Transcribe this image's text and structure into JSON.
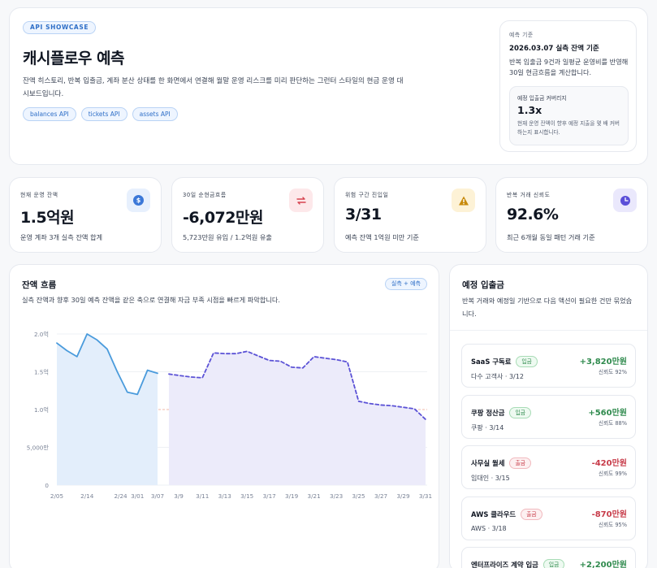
{
  "hero": {
    "badge": "API SHOWCASE",
    "title": "캐시플로우 예측",
    "description": "잔액 히스토리, 반복 입출금, 계좌 분산 상태를 한 화면에서 연결해 월말 운영 리스크를 미리 판단하는 그런터 스타일의 현금 운영 대시보드입니다.",
    "chips": [
      "balances API",
      "tickets API",
      "assets API"
    ]
  },
  "forecast_basis": {
    "label": "예측 기준",
    "date_line": "2026.03.07 실측 잔액 기준",
    "description": "반복 입출금 9건과 일평균 운영비를 반영해 30일 현금흐름을 계산합니다.",
    "coverage": {
      "label": "예정 입출금 커버리지",
      "value": "1.3x",
      "description": "현재 운영 잔액이 향후 예정 지출을 몇 배 커버하는지 표시합니다."
    }
  },
  "kpis": [
    {
      "label": "현재 운영 잔액",
      "value": "1.5억원",
      "sub": "운영 계좌 3개 실측 잔액 합계",
      "icon": "dollar-icon",
      "icon_glyph": "$",
      "icon_bg": "#e7f0fd",
      "icon_color": "#3b78d8"
    },
    {
      "label": "30일 순현금흐름",
      "value": "-6,072만원",
      "sub": "5,723만원 유입 / 1.2억원 유출",
      "icon": "repeat-icon",
      "icon_glyph": "⇄",
      "icon_bg": "#fde8ea",
      "icon_color": "#d6434f"
    },
    {
      "label": "위험 구간 진입일",
      "value": "3/31",
      "sub": "예측 잔액 1억원 미만 기준",
      "icon": "warning-icon",
      "icon_glyph": "!",
      "icon_bg": "#fdf2d6",
      "icon_color": "#c88a0a"
    },
    {
      "label": "반복 거래 신뢰도",
      "value": "92.6%",
      "sub": "최근 6개월 동일 패턴 거래 기준",
      "icon": "clock-icon",
      "icon_glyph": "◔",
      "icon_bg": "#eae8fc",
      "icon_color": "#5b4fd8"
    }
  ],
  "flow": {
    "title": "잔액 흐름",
    "tag": "실측 + 예측",
    "description": "실측 잔액과 향후 30일 예측 잔액을 같은 축으로 연결해 자금 부족 시점을 빠르게 파악합니다."
  },
  "chart_data": {
    "type": "area",
    "y_tick_labels": [
      "0",
      "5,000만",
      "1.0억",
      "1.5억",
      "2.0억"
    ],
    "y_tick_values": [
      0,
      0.5,
      1.0,
      1.5,
      2.0
    ],
    "ylim": [
      0,
      2.0
    ],
    "threshold": 1.0,
    "x_tick_labels": [
      "2/05",
      "2/14",
      "2/24",
      "3/01",
      "3/07",
      "3/9",
      "3/11",
      "3/13",
      "3/15",
      "3/17",
      "3/19",
      "3/21",
      "3/23",
      "3/25",
      "3/27",
      "3/29",
      "3/31"
    ],
    "series": [
      {
        "kind": "actual",
        "color": "#4a9bdc",
        "fill": "#e3eefb",
        "x": [
          "2/05",
          "2/08",
          "2/11",
          "2/14",
          "2/17",
          "2/20",
          "2/23",
          "2/26",
          "3/01",
          "3/04",
          "3/07"
        ],
        "y": [
          1.88,
          1.78,
          1.7,
          2.0,
          1.92,
          1.8,
          1.5,
          1.23,
          1.2,
          1.52,
          1.48
        ]
      },
      {
        "kind": "forecast",
        "color": "#5b52d6",
        "fill": "#ecebfa",
        "x": [
          "3/08",
          "3/09",
          "3/10",
          "3/11",
          "3/12",
          "3/13",
          "3/14",
          "3/15",
          "3/16",
          "3/17",
          "3/18",
          "3/19",
          "3/20",
          "3/21",
          "3/22",
          "3/23",
          "3/24",
          "3/25",
          "3/26",
          "3/27",
          "3/28",
          "3/29",
          "3/30",
          "3/31"
        ],
        "y": [
          1.47,
          1.45,
          1.43,
          1.42,
          1.75,
          1.74,
          1.74,
          1.77,
          1.71,
          1.65,
          1.64,
          1.56,
          1.55,
          1.7,
          1.68,
          1.66,
          1.63,
          1.11,
          1.08,
          1.06,
          1.05,
          1.03,
          1.01,
          0.87
        ]
      }
    ]
  },
  "schedule": {
    "title": "예정 입출금",
    "description": "반복 거래와 예정일 기반으로 다음 액션이 필요한 건만 묶었습니다.",
    "items": [
      {
        "name": "SaaS 구독료",
        "tag": "입금",
        "kind": "in",
        "meta": "다수 고객사 · 3/12",
        "amount": "+3,820만원",
        "confidence": "신뢰도 92%"
      },
      {
        "name": "쿠팡 정산금",
        "tag": "입금",
        "kind": "in",
        "meta": "쿠팡 · 3/14",
        "amount": "+560만원",
        "confidence": "신뢰도 88%"
      },
      {
        "name": "사무실 월세",
        "tag": "출금",
        "kind": "out",
        "meta": "임대인 · 3/15",
        "amount": "-420만원",
        "confidence": "신뢰도 99%"
      },
      {
        "name": "AWS 클라우드",
        "tag": "출금",
        "kind": "out",
        "meta": "AWS · 3/18",
        "amount": "-870만원",
        "confidence": "신뢰도 95%"
      },
      {
        "name": "엔터프라이즈 계약 입금",
        "tag": "입금",
        "kind": "in",
        "meta": "",
        "amount": "+2,200만원",
        "confidence": ""
      }
    ]
  }
}
